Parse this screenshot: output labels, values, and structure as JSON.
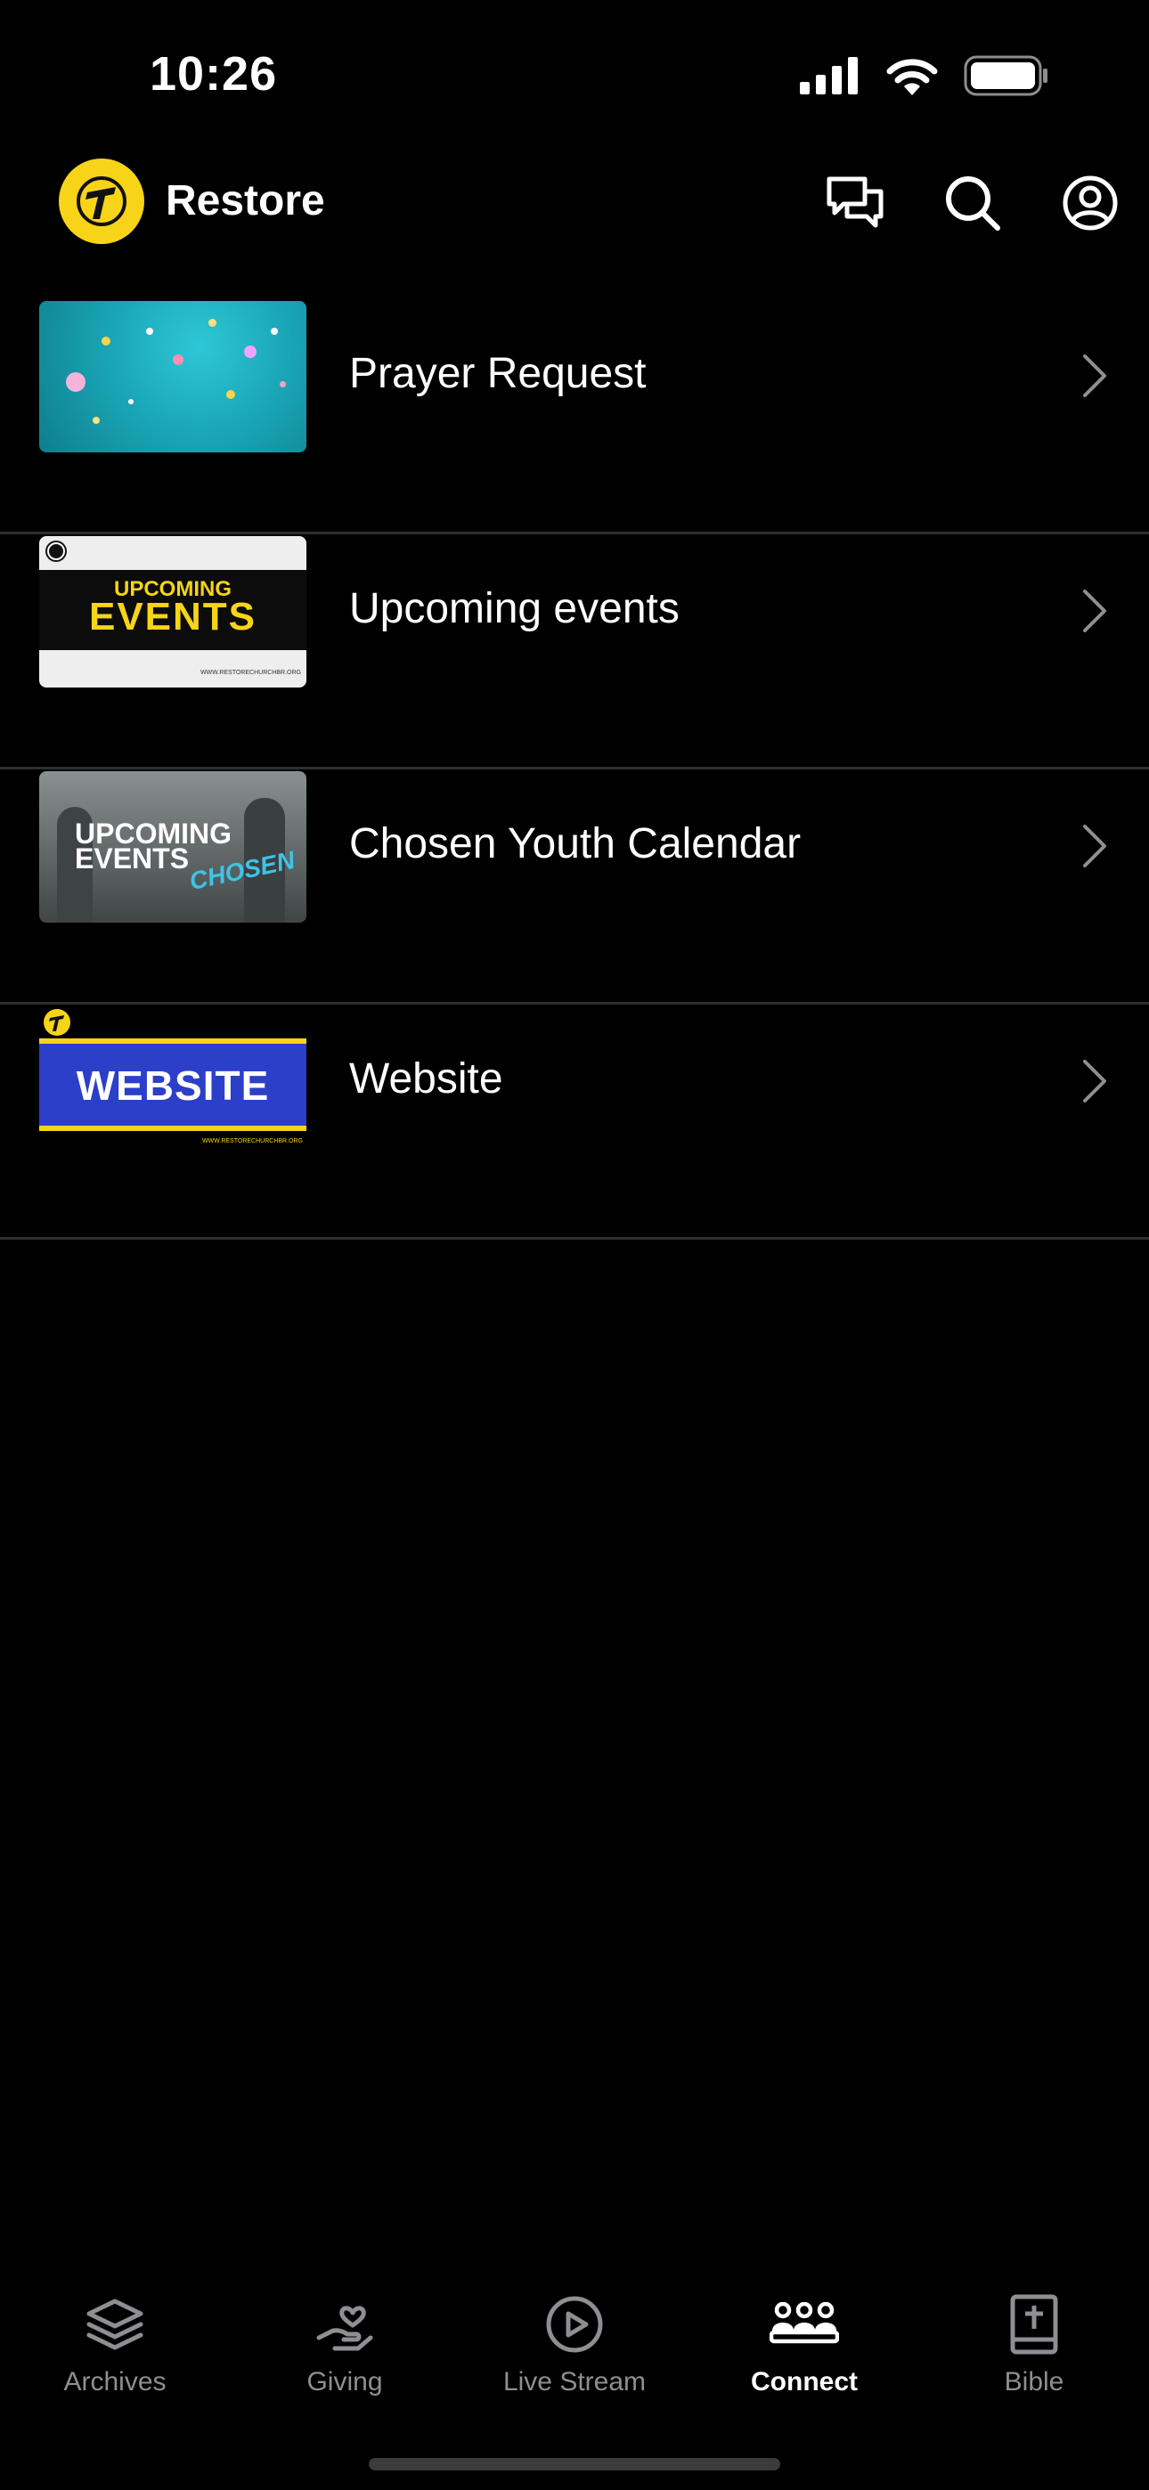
{
  "status": {
    "time": "10:26"
  },
  "header": {
    "app_name": "Restore",
    "accent": "#f7d417"
  },
  "list": [
    {
      "label": "Prayer Request",
      "thumb": "confetti-image"
    },
    {
      "label": "Upcoming events",
      "thumb": "upcoming-events-banner",
      "thumb_line1": "UPCOMING",
      "thumb_line2": "EVENTS",
      "thumb_url": "WWW.RESTORECHURCHBR.ORG"
    },
    {
      "label": "Chosen Youth Calendar",
      "thumb": "youth-events-photo",
      "thumb_line1": "UPCOMING",
      "thumb_line2": "EVENTS",
      "thumb_badge": "CHOSEN"
    },
    {
      "label": "Website",
      "thumb": "website-banner",
      "thumb_line1": "WEBSITE",
      "thumb_url": "WWW.RESTORECHURCHBR.ORG"
    }
  ],
  "tabs": [
    {
      "label": "Archives",
      "icon": "layers-icon"
    },
    {
      "label": "Giving",
      "icon": "heart-hand-icon"
    },
    {
      "label": "Live Stream",
      "icon": "play-circle-icon"
    },
    {
      "label": "Connect",
      "icon": "people-icon",
      "active": true
    },
    {
      "label": "Bible",
      "icon": "bible-icon"
    }
  ]
}
